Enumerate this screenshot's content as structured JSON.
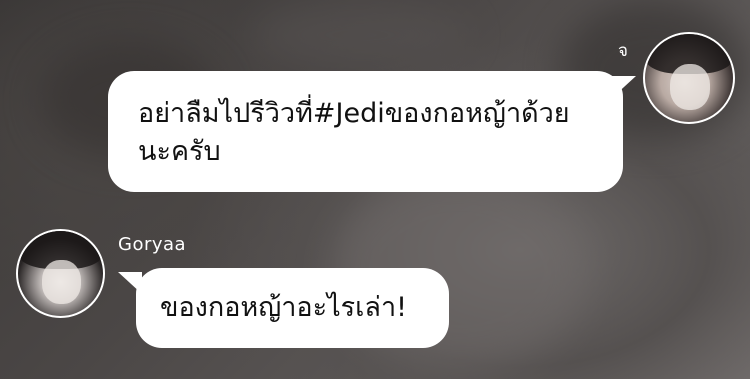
{
  "chat": {
    "messages": [
      {
        "sender": "จ",
        "side": "right",
        "text": "อย่าลืมไปรีวิวที่#Jediของกอหญ้าด้วยนะครับ"
      },
      {
        "sender": "Goryaa",
        "side": "left",
        "text": "ของกอหญ้าอะไรเล่า!"
      }
    ]
  }
}
